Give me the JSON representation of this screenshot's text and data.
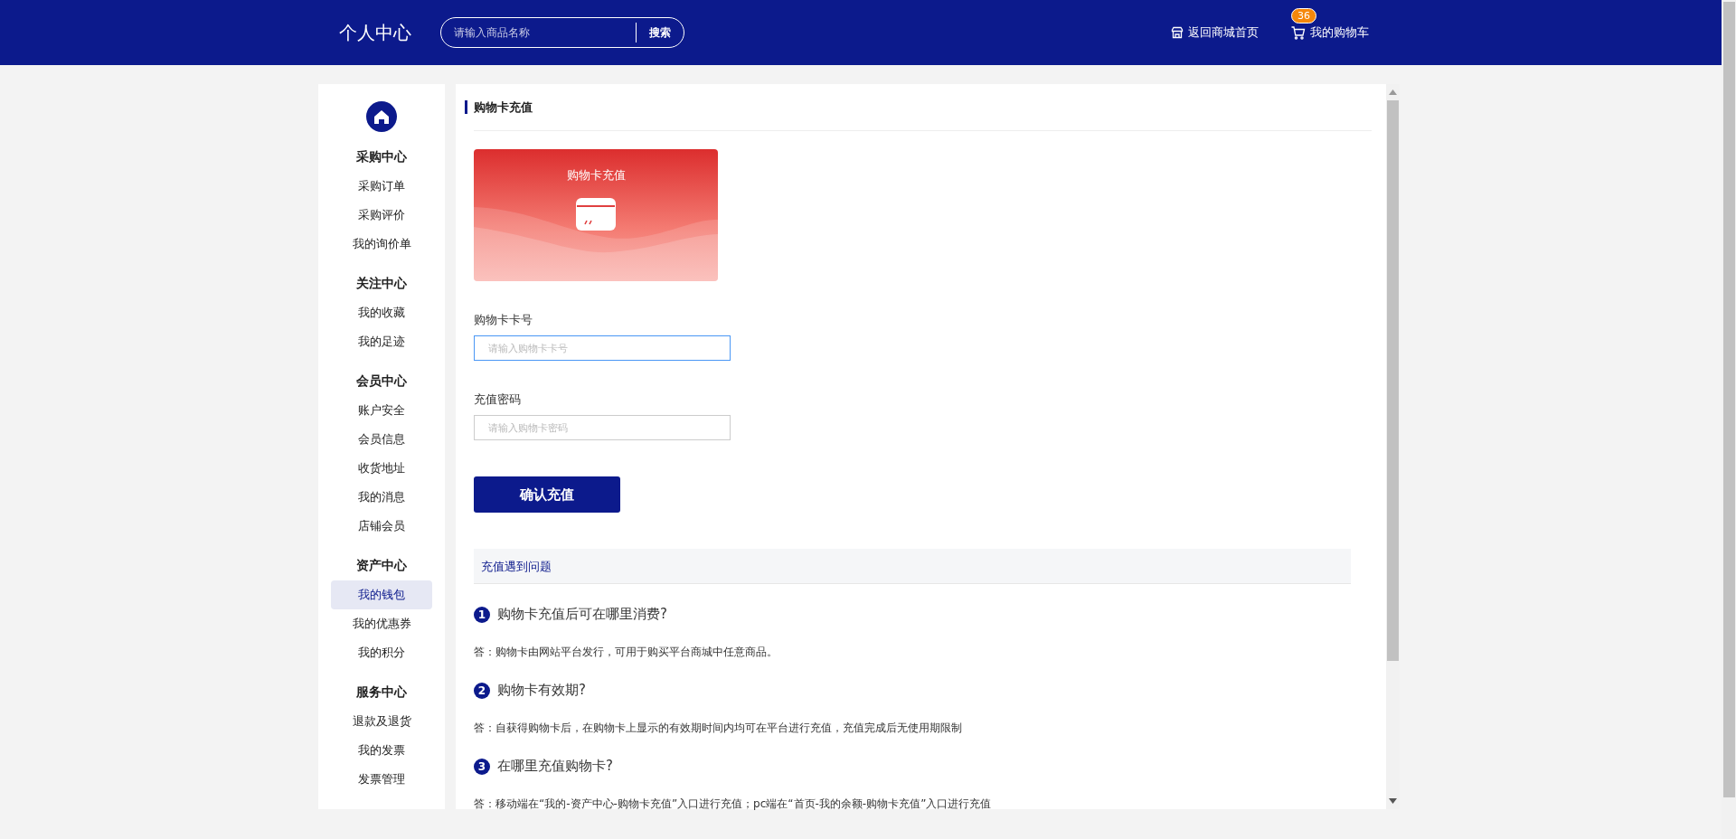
{
  "header": {
    "title": "个人中心",
    "search": {
      "placeholder": "请输入商品名称",
      "button": "搜索"
    },
    "home_link": "返回商城首页",
    "cart": {
      "label": "我的购物车",
      "badge": "36"
    }
  },
  "sidebar": {
    "groups": [
      {
        "title": "采购中心",
        "items": [
          {
            "label": "采购订单",
            "selected": false
          },
          {
            "label": "采购评价",
            "selected": false
          },
          {
            "label": "我的询价单",
            "selected": false
          }
        ]
      },
      {
        "title": "关注中心",
        "items": [
          {
            "label": "我的收藏",
            "selected": false
          },
          {
            "label": "我的足迹",
            "selected": false
          }
        ]
      },
      {
        "title": "会员中心",
        "items": [
          {
            "label": "账户安全",
            "selected": false
          },
          {
            "label": "会员信息",
            "selected": false
          },
          {
            "label": "收货地址",
            "selected": false
          },
          {
            "label": "我的消息",
            "selected": false
          },
          {
            "label": "店铺会员",
            "selected": false
          }
        ]
      },
      {
        "title": "资产中心",
        "items": [
          {
            "label": "我的钱包",
            "selected": true
          },
          {
            "label": "我的优惠券",
            "selected": false
          },
          {
            "label": "我的积分",
            "selected": false
          }
        ]
      },
      {
        "title": "服务中心",
        "items": [
          {
            "label": "退款及退货",
            "selected": false
          },
          {
            "label": "我的发票",
            "selected": false
          },
          {
            "label": "发票管理",
            "selected": false
          }
        ]
      }
    ]
  },
  "main": {
    "title": "购物卡充值",
    "card": {
      "title": "购物卡充值"
    },
    "fields": [
      {
        "label": "购物卡卡号",
        "placeholder": "请输入购物卡卡号",
        "focused": true
      },
      {
        "label": "充值密码",
        "placeholder": "请输入购物卡密码",
        "focused": false
      }
    ],
    "submit": "确认充值",
    "faq": {
      "title": "充值遇到问题",
      "items": [
        {
          "number": "1",
          "question": "购物卡充值后可在哪里消费?",
          "answer": "答：购物卡由网站平台发行，可用于购买平台商城中任意商品。"
        },
        {
          "number": "2",
          "question": "购物卡有效期?",
          "answer": "答：自获得购物卡后，在购物卡上显示的有效期时间内均可在平台进行充值，充值完成后无使用期限制"
        },
        {
          "number": "3",
          "question": "在哪里充值购物卡?",
          "answer": "答：移动端在“我的-资产中心-购物卡充值”入口进行充值；pc端在“首页-我的余额-购物卡充值”入口进行充值"
        }
      ]
    }
  }
}
